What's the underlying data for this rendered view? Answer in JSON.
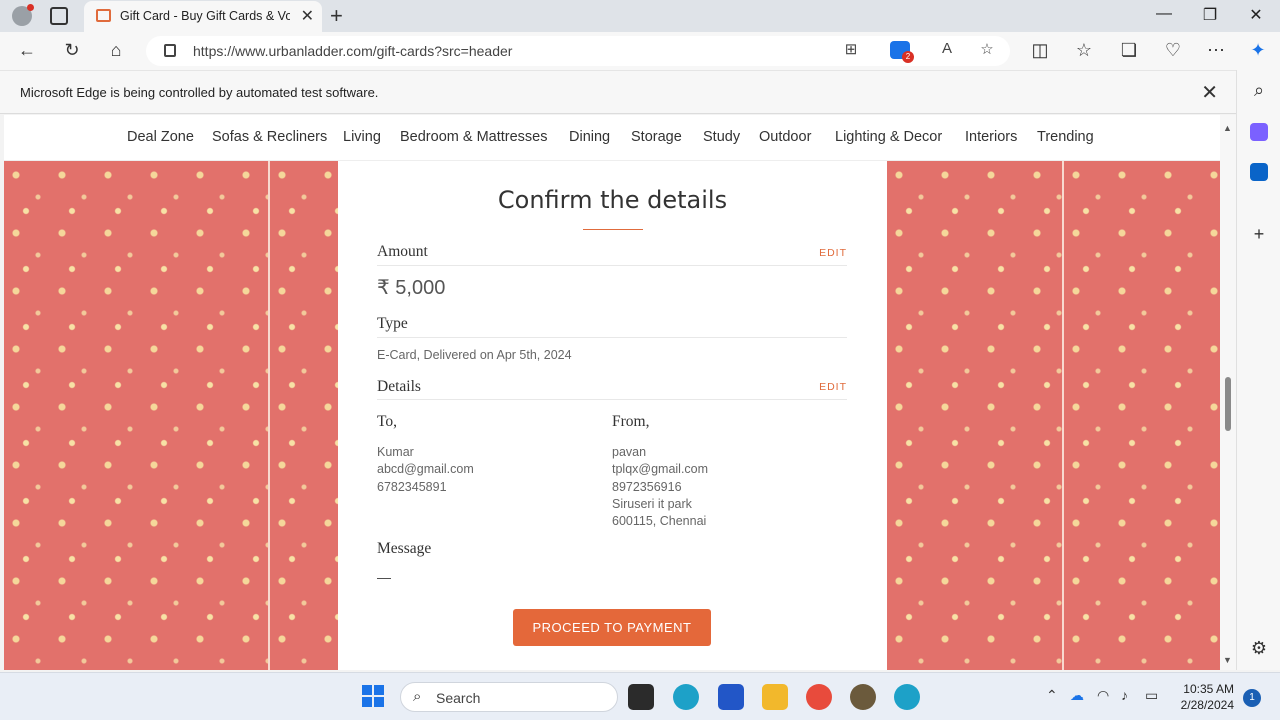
{
  "browser": {
    "tab_title": "Gift Card - Buy Gift Cards & Vouchers",
    "tab_close": "✕",
    "new_tab": "+",
    "window_controls": [
      "—",
      "❐",
      "✕"
    ],
    "url": "https://www.urbanladder.com/gift-cards?src=header",
    "extension_badge_count": "2",
    "automation_message": "Microsoft Edge is being controlled by automated test software.",
    "infobar_close": "✕"
  },
  "site_nav": {
    "items": [
      "Deal Zone",
      "Sofas & Recliners",
      "Living",
      "Bedroom & Mattresses",
      "Dining",
      "Storage",
      "Study",
      "Outdoor",
      "Lighting & Decor",
      "Interiors",
      "Trending"
    ]
  },
  "confirm": {
    "title": "Confirm the details",
    "amount_label": "Amount",
    "edit_label": "EDIT",
    "amount_value": "₹ 5,000",
    "type_label": "Type",
    "type_value": "E-Card, Delivered on Apr 5th, 2024",
    "details_label": "Details",
    "to_label": "To,",
    "to": {
      "name": "Kumar",
      "email": "abcd@gmail.com",
      "phone": "6782345891"
    },
    "from_label": "From,",
    "from": {
      "name": "pavan",
      "email": "tplqx@gmail.com",
      "phone": "8972356916",
      "address1": "Siruseri it park",
      "address2": "600115, Chennai"
    },
    "message_label": "Message",
    "message_value": "—",
    "proceed_label": "PROCEED TO PAYMENT"
  },
  "taskbar": {
    "search_label": "Search",
    "time": "10:35 AM",
    "date": "2/28/2024",
    "notification_count": "1"
  },
  "colors": {
    "accent": "#e4683a",
    "pattern": "#e2716b"
  }
}
